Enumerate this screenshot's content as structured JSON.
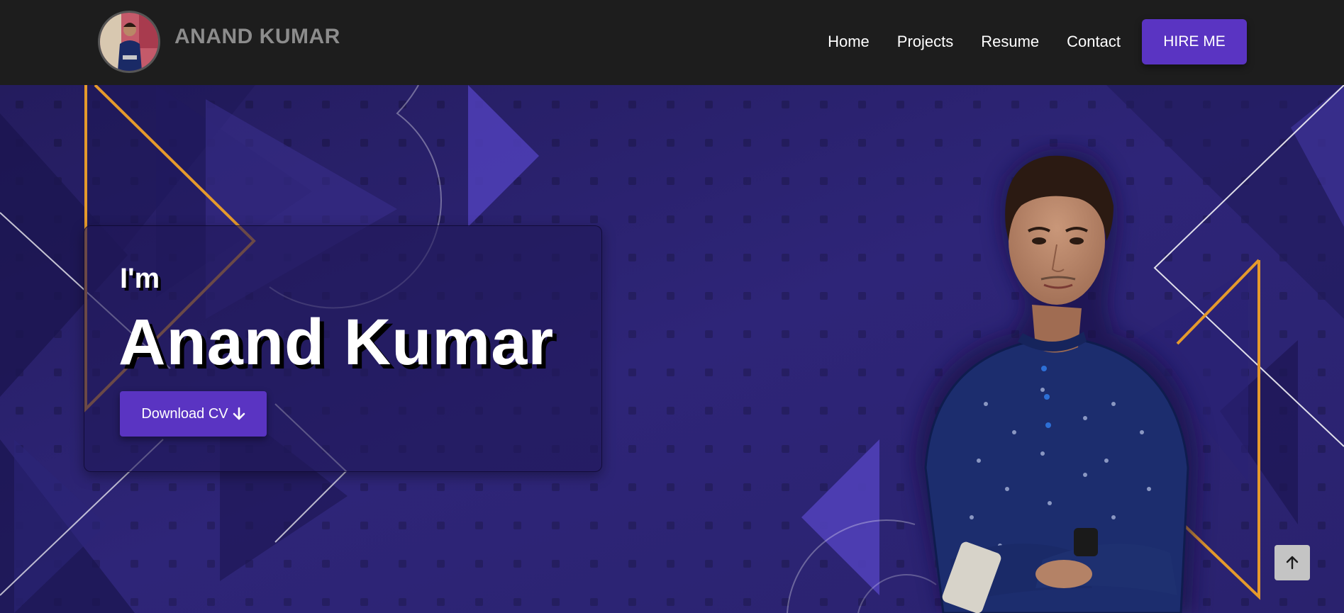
{
  "header": {
    "brand_name": "ANAND KUMAR",
    "nav": [
      "Home",
      "Projects",
      "Resume",
      "Contact"
    ],
    "hire_label": "HIRE ME"
  },
  "hero": {
    "intro": "I'm",
    "name": "Anand Kumar",
    "cv_label": "Download CV"
  },
  "icons": {
    "download": "arrow-down-icon",
    "scroll_top": "arrow-up-icon"
  },
  "colors": {
    "navbar": "#1d1d1d",
    "accent": "#5a34c2",
    "hero_bg": "#2a2270",
    "gold": "#e59a2c",
    "brand_text": "#8c8c8c"
  }
}
